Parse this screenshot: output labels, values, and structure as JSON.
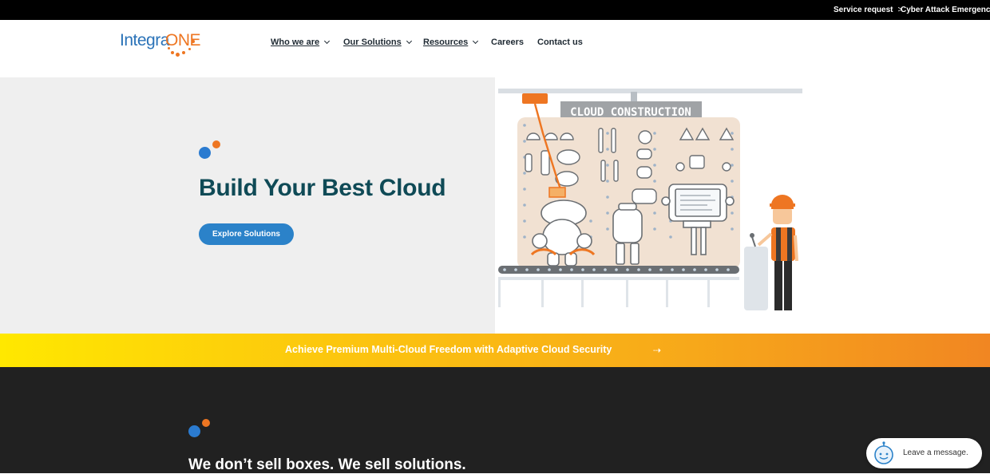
{
  "topbar": {
    "links": [
      {
        "label": "Service request",
        "chevron": ">"
      },
      {
        "label": "Cyber Attack Emergency",
        "chevron": ">"
      }
    ]
  },
  "header": {
    "logo": {
      "text_primary": "Integra",
      "text_accent": "ONE"
    },
    "nav": [
      {
        "label": "Who we are",
        "has_dropdown": true
      },
      {
        "label": "Our Solutions",
        "has_dropdown": true
      },
      {
        "label": "Resources",
        "has_dropdown": true
      },
      {
        "label": "Careers",
        "has_dropdown": false
      },
      {
        "label": "Contact us",
        "has_dropdown": false
      }
    ]
  },
  "hero": {
    "title": "Build Your Best Cloud",
    "cta_label": "Explore Solutions",
    "illustration": {
      "sign_text": "CLOUD CONSTRUCTION"
    }
  },
  "banner": {
    "text": "Achieve Premium Multi-Cloud Freedom with Adaptive Cloud Security",
    "arrow_icon": "arrow-right-icon"
  },
  "section": {
    "title": "We don’t sell boxes. We sell solutions."
  },
  "chat": {
    "label": "Leave a message.",
    "icon": "chat-robot-icon"
  },
  "colors": {
    "brand_blue": "#2b73b8",
    "brand_orange": "#ee7622",
    "hero_title": "#0f4a56",
    "cta_blue": "#2b82c9",
    "dark_bg": "#212121",
    "banner_start": "#ffe800",
    "banner_end": "#f18622"
  }
}
